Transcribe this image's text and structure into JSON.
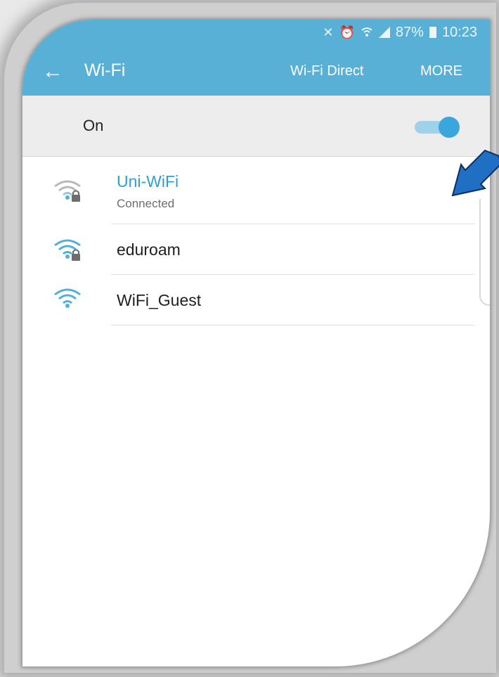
{
  "status_bar": {
    "icons": [
      "mute-icon",
      "alarm-icon",
      "wifi-status-icon",
      "signal-icon"
    ],
    "battery_percent": "87%",
    "time": "10:23"
  },
  "toolbar": {
    "back_icon": "arrow-left-icon",
    "title": "Wi-Fi",
    "action_direct": "Wi-Fi Direct",
    "action_more": "MORE"
  },
  "toggle": {
    "label": "On",
    "state": true
  },
  "networks": [
    {
      "name": "Uni-WiFi",
      "status": "Connected",
      "secured": true,
      "connected": true
    },
    {
      "name": "eduroam",
      "status": "",
      "secured": true,
      "connected": false
    },
    {
      "name": "WiFi_Guest",
      "status": "",
      "secured": false,
      "connected": false
    }
  ],
  "colors": {
    "appbar": "#58b0d6",
    "accent": "#2f9fd3",
    "annotation_arrow": "#1f6fc5"
  }
}
